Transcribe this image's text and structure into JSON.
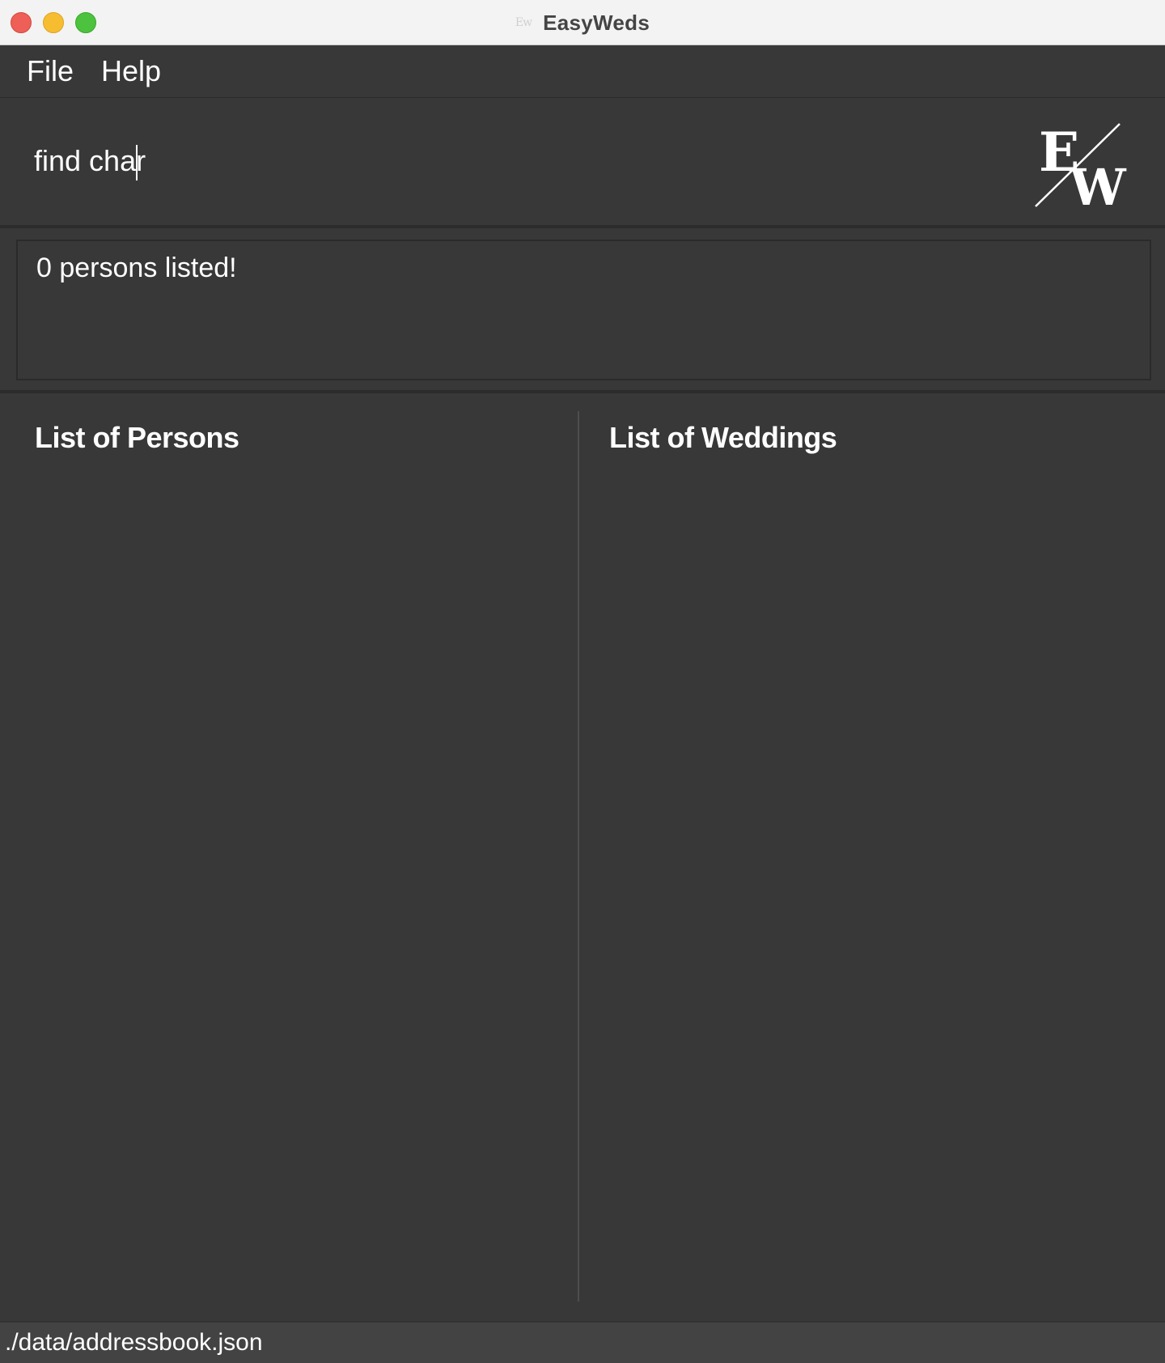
{
  "window": {
    "title": "EasyWeds",
    "title_icon": "Ew"
  },
  "menu": {
    "items": [
      {
        "label": "File"
      },
      {
        "label": "Help"
      }
    ]
  },
  "command": {
    "value": "find char",
    "placeholder": ""
  },
  "logo": {
    "icon": "easyweds-logo",
    "letters": [
      "E",
      "W"
    ]
  },
  "result": {
    "message": "0 persons listed!"
  },
  "panels": {
    "persons": {
      "title": "List of Persons",
      "items": []
    },
    "weddings": {
      "title": "List of Weddings",
      "items": []
    }
  },
  "status": {
    "file_path": "./data/addressbook.json"
  },
  "colors": {
    "background": "#383838",
    "titlebar": "#f3f3f3",
    "statusbar": "#434343",
    "text": "#ffffff",
    "close": "#ee5f57",
    "minimize": "#f7bd31",
    "maximize": "#4cc23f"
  }
}
